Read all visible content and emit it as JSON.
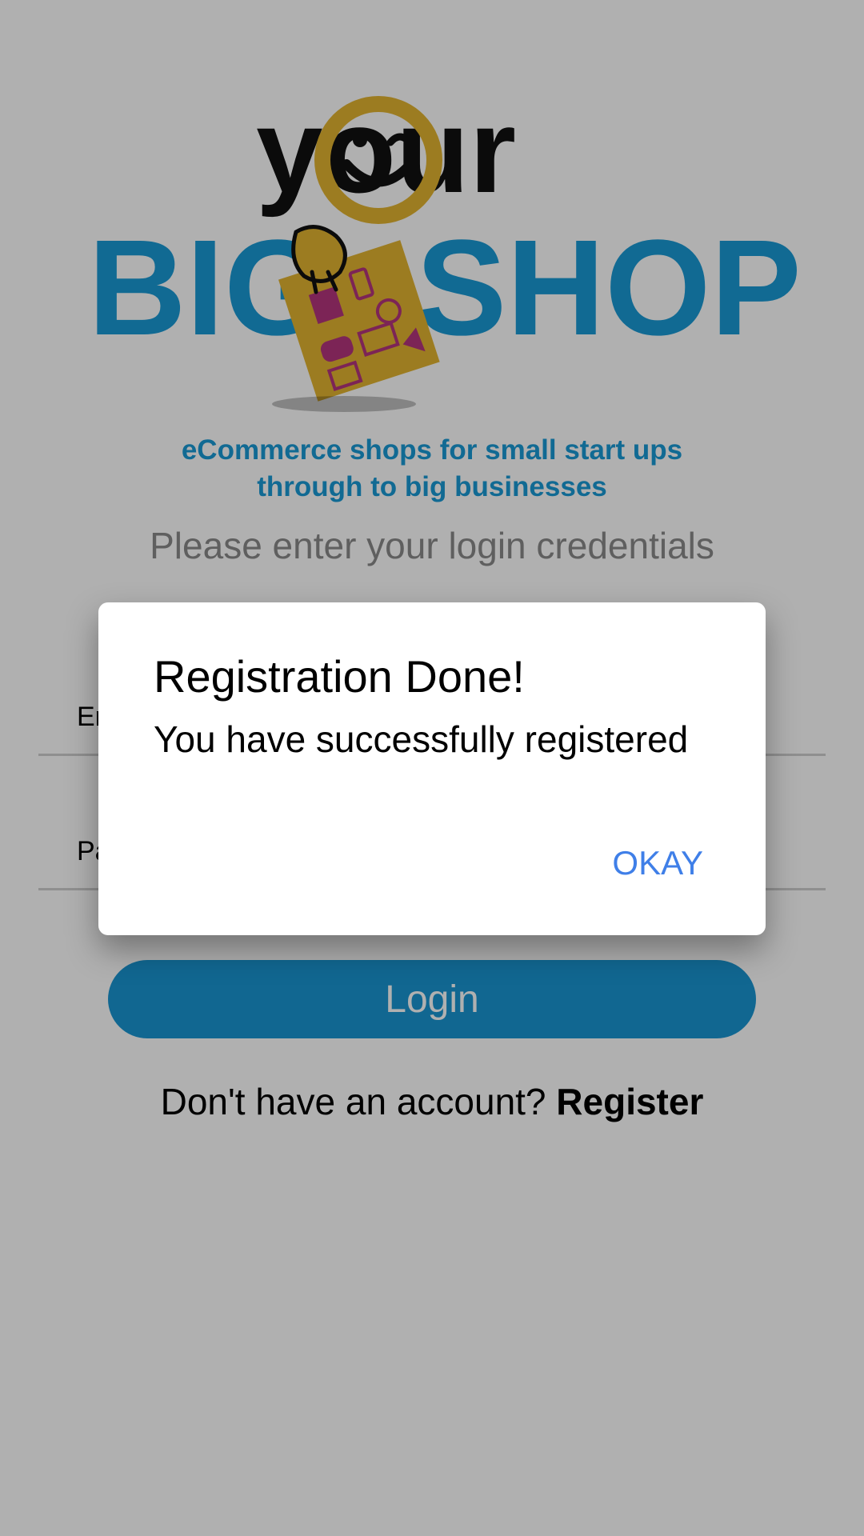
{
  "logo": {
    "your": "your",
    "big": "BIG",
    "shop": "SHOP",
    "colors": {
      "blue": "#1a9ad6",
      "yellow": "#e3b431",
      "magenta": "#b4357d",
      "dark": "#111111"
    }
  },
  "tagline": {
    "line1": "eCommerce shops for small start ups",
    "line2": "through to big businesses"
  },
  "prompt": "Please enter your login credentials",
  "form": {
    "email_placeholder": "Email",
    "password_placeholder": "Password",
    "login_label": "Login"
  },
  "register": {
    "question": "Don't have an account?",
    "link": "Register"
  },
  "dialog": {
    "title": "Registration Done!",
    "message": "You have successfully registered",
    "okay_label": "OKAY"
  },
  "colors": {
    "accent": "#1a96d2",
    "dialog_button": "#3f7fe8",
    "overlay": "rgba(0,0,0,0.31)"
  }
}
